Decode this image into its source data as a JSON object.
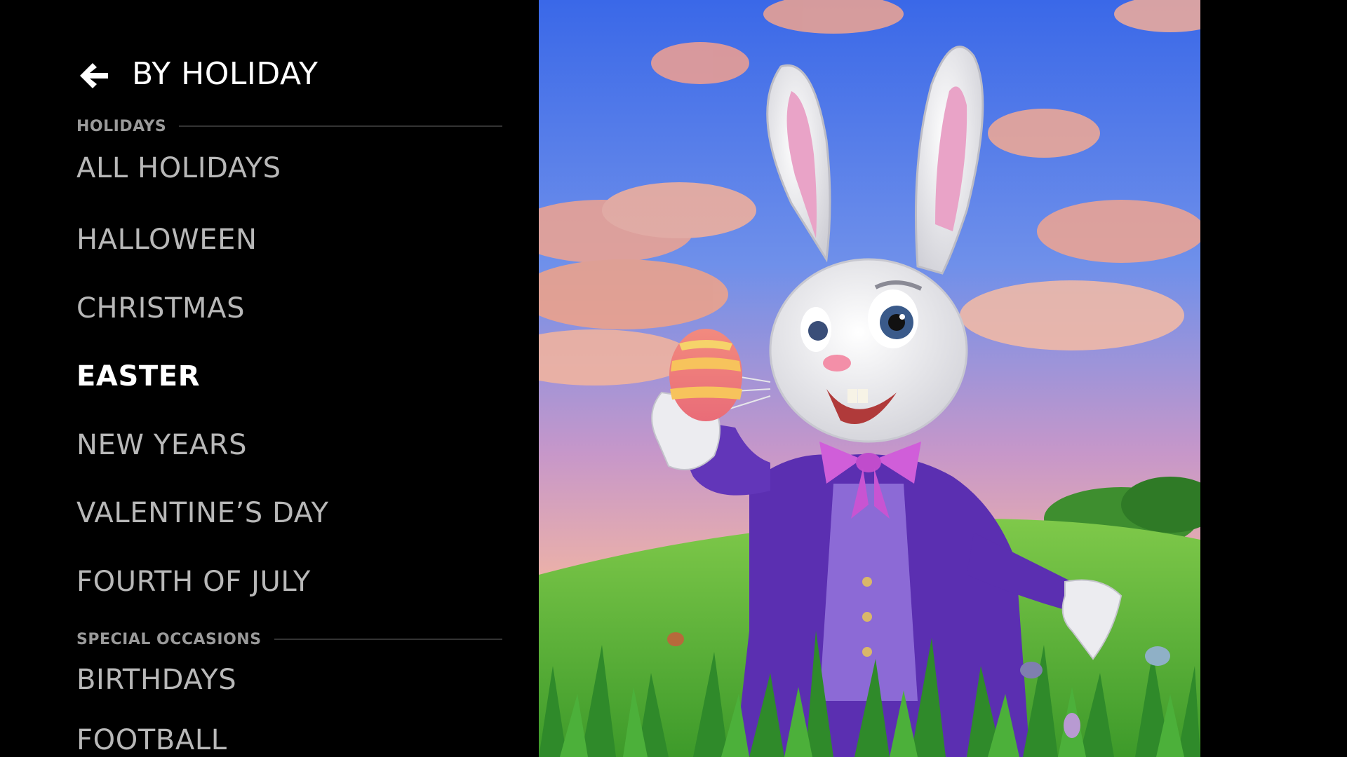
{
  "header": {
    "title": "BY HOLIDAY",
    "back_icon": "arrow-left-icon"
  },
  "sections": {
    "holidays": {
      "label": "HOLIDAYS"
    },
    "special": {
      "label": "SPECIAL OCCASIONS"
    }
  },
  "menu": {
    "all_holidays": "ALL HOLIDAYS",
    "halloween": "HALLOWEEN",
    "christmas": "CHRISTMAS",
    "easter": "EASTER",
    "new_years": "NEW YEARS",
    "valentines": "VALENTINE’S DAY",
    "fourth_of_july": "FOURTH OF JULY",
    "birthdays": "BIRTHDAYS",
    "football": "FOOTBALL"
  },
  "selected": "EASTER",
  "colors": {
    "background": "#000000",
    "text_selected": "#ffffff",
    "text_default": "#b8b8b8",
    "section_label": "#9a9a9a",
    "divider": "#333333"
  }
}
